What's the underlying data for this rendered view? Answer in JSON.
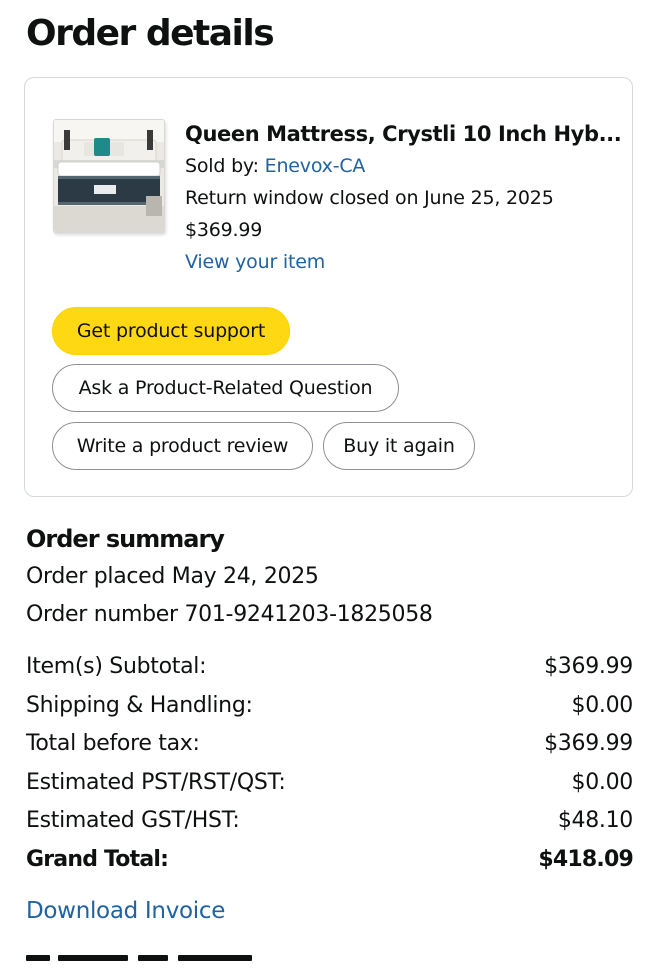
{
  "page": {
    "title": "Order details"
  },
  "item": {
    "image_icon": "mattress-product-image",
    "title": "Queen Mattress, Crystli 10 Inch Hyb...",
    "sold_by_label": "Sold by: ",
    "seller": "Enevox-CA",
    "return_window": "Return window closed on June 25, 2025",
    "price": "$369.99",
    "view_item_link": "View your item"
  },
  "actions": {
    "get_support": "Get product support",
    "ask_question": "Ask a Product-Related Question",
    "write_review": "Write a product review",
    "buy_again": "Buy it again"
  },
  "summary": {
    "title": "Order summary",
    "placed": "Order placed May 24, 2025",
    "number": "Order number 701-9241203-1825058",
    "rows": [
      {
        "label": "Item(s) Subtotal:",
        "value": "$369.99"
      },
      {
        "label": "Shipping & Handling:",
        "value": "$0.00"
      },
      {
        "label": "Total before tax:",
        "value": "$369.99"
      },
      {
        "label": "Estimated PST/RST/QST:",
        "value": "$0.00"
      },
      {
        "label": "Estimated GST/HST:",
        "value": "$48.10"
      },
      {
        "label": "Grand Total:",
        "value": "$418.09"
      }
    ],
    "download_invoice": "Download Invoice"
  },
  "colors": {
    "link": "#2162a1",
    "primary_button": "#ffd814",
    "text": "#0f1111",
    "border": "#d5d9d9"
  }
}
